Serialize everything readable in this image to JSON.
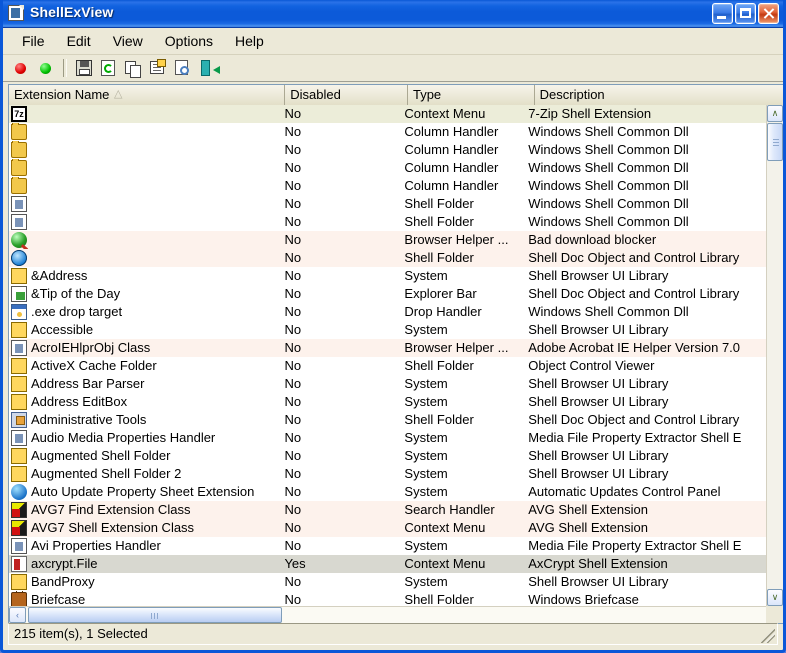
{
  "window": {
    "title": "ShellExView",
    "icon": "shell-extension-icon",
    "buttons": {
      "minimize": "Minimize",
      "maximize": "Maximize",
      "close": "Close"
    }
  },
  "menu": {
    "items": [
      "File",
      "Edit",
      "View",
      "Options",
      "Help"
    ]
  },
  "toolbar": {
    "items": [
      {
        "name": "enable-selected-items",
        "icon": "red-led-icon"
      },
      {
        "name": "disable-selected-items",
        "icon": "green-led-icon"
      },
      {
        "name": "separator",
        "icon": "separator"
      },
      {
        "name": "save-selected-items",
        "icon": "floppy-save-icon"
      },
      {
        "name": "refresh",
        "icon": "refresh-page-icon"
      },
      {
        "name": "copy",
        "icon": "copy-icon"
      },
      {
        "name": "properties",
        "icon": "properties-icon"
      },
      {
        "name": "find",
        "icon": "find-magnifier-icon"
      },
      {
        "name": "exit",
        "icon": "exit-door-icon"
      }
    ]
  },
  "list": {
    "columns": [
      {
        "key": "name",
        "label": "Extension Name",
        "sorted": true,
        "sort_glyph": "△"
      },
      {
        "key": "disabled",
        "label": "Disabled"
      },
      {
        "key": "type",
        "label": "Type"
      },
      {
        "key": "description",
        "label": "Description"
      }
    ],
    "rows": [
      {
        "icon": "7zip-icon",
        "name": "",
        "disabled": "No",
        "type": "Context Menu",
        "description": "7-Zip Shell Extension",
        "band": "olive",
        "selected": false
      },
      {
        "icon": "folder-icon",
        "name": "",
        "disabled": "No",
        "type": "Column Handler",
        "description": "Windows Shell Common Dll",
        "band": "white",
        "selected": false
      },
      {
        "icon": "folder-icon",
        "name": "",
        "disabled": "No",
        "type": "Column Handler",
        "description": "Windows Shell Common Dll",
        "band": "white",
        "selected": false
      },
      {
        "icon": "folder-icon",
        "name": "",
        "disabled": "No",
        "type": "Column Handler",
        "description": "Windows Shell Common Dll",
        "band": "white",
        "selected": false
      },
      {
        "icon": "folder-icon",
        "name": "",
        "disabled": "No",
        "type": "Column Handler",
        "description": "Windows Shell Common Dll",
        "band": "white",
        "selected": false
      },
      {
        "icon": "printer-doc-icon",
        "name": "",
        "disabled": "No",
        "type": "Shell Folder",
        "description": "Windows Shell Common Dll",
        "band": "white",
        "selected": false
      },
      {
        "icon": "doc-pen-icon",
        "name": "",
        "disabled": "No",
        "type": "Shell Folder",
        "description": "Windows Shell Common Dll",
        "band": "white",
        "selected": false
      },
      {
        "icon": "globe-search-icon",
        "name": "",
        "disabled": "No",
        "type": "Browser Helper ...",
        "description": "Bad download blocker",
        "band": "pink",
        "selected": false
      },
      {
        "icon": "ie-icon",
        "name": "",
        "disabled": "No",
        "type": "Shell Folder",
        "description": "Shell Doc Object and Control Library",
        "band": "pink",
        "selected": false
      },
      {
        "icon": "folder-star-icon",
        "name": "&Address",
        "disabled": "No",
        "type": "System",
        "description": "Shell Browser UI Library",
        "band": "white",
        "selected": false
      },
      {
        "icon": "tip-of-day-icon",
        "name": "&Tip of the Day",
        "disabled": "No",
        "type": "Explorer Bar",
        "description": "Shell Doc Object and Control Library",
        "band": "white",
        "selected": false
      },
      {
        "icon": "exe-drop-icon",
        "name": ".exe drop target",
        "disabled": "No",
        "type": "Drop Handler",
        "description": "Windows Shell Common Dll",
        "band": "white",
        "selected": false
      },
      {
        "icon": "folder-star-icon",
        "name": "Accessible",
        "disabled": "No",
        "type": "System",
        "description": "Shell Browser UI Library",
        "band": "white",
        "selected": false
      },
      {
        "icon": "doc-icon",
        "name": "AcroIEHlprObj Class",
        "disabled": "No",
        "type": "Browser Helper ...",
        "description": "Adobe Acrobat IE Helper Version 7.0",
        "band": "pink",
        "selected": false
      },
      {
        "icon": "folder-ie-icon",
        "name": "ActiveX Cache Folder",
        "disabled": "No",
        "type": "Shell Folder",
        "description": "Object Control Viewer",
        "band": "white",
        "selected": false
      },
      {
        "icon": "folder-star-icon",
        "name": "Address Bar Parser",
        "disabled": "No",
        "type": "System",
        "description": "Shell Browser UI Library",
        "band": "white",
        "selected": false
      },
      {
        "icon": "folder-star-icon",
        "name": "Address EditBox",
        "disabled": "No",
        "type": "System",
        "description": "Shell Browser UI Library",
        "band": "white",
        "selected": false
      },
      {
        "icon": "admin-tools-icon",
        "name": "Administrative Tools",
        "disabled": "No",
        "type": "Shell Folder",
        "description": "Shell Doc Object and Control Library",
        "band": "white",
        "selected": false
      },
      {
        "icon": "doc-icon",
        "name": "Audio Media Properties Handler",
        "disabled": "No",
        "type": "System",
        "description": "Media File Property Extractor Shell E",
        "band": "white",
        "selected": false
      },
      {
        "icon": "folder-star-icon",
        "name": "Augmented Shell Folder",
        "disabled": "No",
        "type": "System",
        "description": "Shell Browser UI Library",
        "band": "white",
        "selected": false
      },
      {
        "icon": "folder-star-icon",
        "name": "Augmented Shell Folder 2",
        "disabled": "No",
        "type": "System",
        "description": "Shell Browser UI Library",
        "band": "white",
        "selected": false
      },
      {
        "icon": "globe-update-icon",
        "name": "Auto Update Property Sheet Extension",
        "disabled": "No",
        "type": "System",
        "description": "Automatic Updates Control Panel",
        "band": "white",
        "selected": false
      },
      {
        "icon": "avg-icon",
        "name": "AVG7 Find Extension Class",
        "disabled": "No",
        "type": "Search Handler",
        "description": "AVG Shell Extension",
        "band": "pink",
        "selected": false
      },
      {
        "icon": "avg-icon",
        "name": "AVG7 Shell Extension Class",
        "disabled": "No",
        "type": "Context Menu",
        "description": "AVG Shell Extension",
        "band": "pink",
        "selected": false
      },
      {
        "icon": "doc-icon",
        "name": "Avi Properties Handler",
        "disabled": "No",
        "type": "System",
        "description": "Media File Property Extractor Shell E",
        "band": "white",
        "selected": false
      },
      {
        "icon": "axcrypt-icon",
        "name": "axcrypt.File",
        "disabled": "Yes",
        "type": "Context Menu",
        "description": "AxCrypt Shell Extension",
        "band": "white",
        "selected": true
      },
      {
        "icon": "folder-star-icon",
        "name": "BandProxy",
        "disabled": "No",
        "type": "System",
        "description": "Shell Browser UI Library",
        "band": "white",
        "selected": false
      },
      {
        "icon": "briefcase-icon",
        "name": "Briefcase",
        "disabled": "No",
        "type": "Shell Folder",
        "description": "Windows Briefcase",
        "band": "white",
        "selected": false
      }
    ]
  },
  "scrollbars": {
    "vertical": {
      "up_glyph": "∧",
      "down_glyph": "∨"
    },
    "horizontal": {
      "left_glyph": "‹",
      "right_glyph": "›"
    }
  },
  "statusbar": {
    "text": "215 item(s), 1 Selected"
  },
  "colors": {
    "title_blue": "#0c5ad9",
    "chrome": "#ece9d8",
    "band_olive": "#ecedd9",
    "band_pink": "#fdf2ec",
    "selection_gray": "#d8d8d0"
  }
}
